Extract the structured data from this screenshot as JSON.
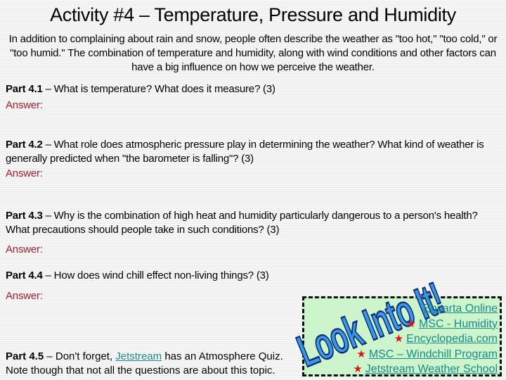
{
  "title": "Activity #4 – Temperature, Pressure and Humidity",
  "intro": "In addition to complaining about rain and snow, people often describe the weather as \"too hot,\" \"too cold,\" or \"too humid.\" The combination of temperature and humidity, along with wind conditions and other factors can have a big influence on how we perceive the weather.",
  "answer_label": "Answer:",
  "parts": [
    {
      "label": "Part 4.1",
      "text": " – What is temperature? What does it measure? (3)"
    },
    {
      "label": "Part 4.2",
      "text": " – What role does atmospheric pressure play in determining the weather? What kind of weather is generally predicted when \"the barometer is falling\"? (3)"
    },
    {
      "label": "Part 4.3",
      "text": " – Why is the combination of high heat and humidity particularly dangerous to a person's health? What precautions should people take in such conditions? (3)"
    },
    {
      "label": "Part 4.4",
      "text": " – How does wind chill effect non-living things? (3)"
    }
  ],
  "part5": {
    "label": "Part 4.5",
    "text_before": " – Don't forget, ",
    "link": "Jetstream",
    "text_after": " has an Atmosphere Quiz. Note though that not all the questions are about this topic."
  },
  "look_into_it": {
    "heading": "Look Into It!",
    "links": [
      {
        "label": "Encarta Online",
        "star": false
      },
      {
        "label": "MSC - Humidity",
        "star": true
      },
      {
        "label": "Encyclopedia.com",
        "star": true
      },
      {
        "label": "MSC – Windchill Program",
        "star": true
      },
      {
        "label": "Jetstream Weather School",
        "star": true
      }
    ]
  },
  "colors": {
    "answer": "#a0202a",
    "link": "#1a8a8a",
    "box_bg": "#ccf5cc",
    "star": "#e01010"
  }
}
